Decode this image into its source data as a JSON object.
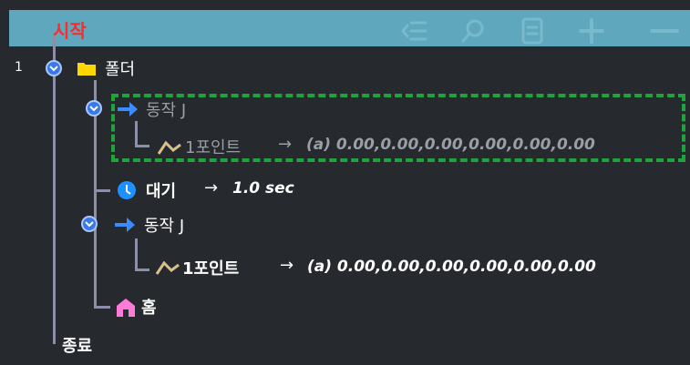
{
  "toolbar": {
    "start_label": "시작",
    "icons": [
      "list-indent-icon",
      "search-icon",
      "document-icon",
      "plus-icon",
      "minus-icon"
    ]
  },
  "tree": {
    "row_number": "1",
    "folder": {
      "label": "폴더"
    },
    "move1": {
      "label": "동작 J",
      "point_label": "1포인트",
      "arrow": "→",
      "values": "(a) 0.00,0.00,0.00,0.00,0.00,0.00"
    },
    "wait": {
      "label": "대기",
      "arrow": "→",
      "value": "1.0 sec"
    },
    "move2": {
      "label": "동작 J",
      "point_label": "1포인트",
      "arrow": "→",
      "values": "(a) 0.00,0.00,0.00,0.00,0.00,0.00"
    },
    "home": {
      "label": "홈"
    },
    "end_label": "종료"
  },
  "colors": {
    "toolbar": "#5fa7bd",
    "background": "#26292d",
    "start": "#ff2a2a",
    "selection": "#1ea43a",
    "folder": "#ffd700",
    "arrow": "#3b8cff",
    "home": "#ff7ad9"
  }
}
